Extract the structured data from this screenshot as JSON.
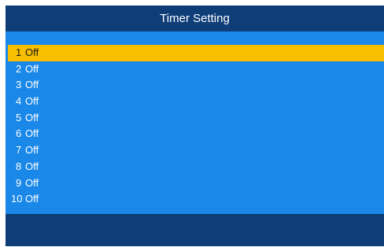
{
  "header": {
    "title": "Timer Setting"
  },
  "colors": {
    "header_bg": "#0e3d78",
    "body_bg": "#1a88e8",
    "selected_bg": "#f7bf00",
    "text": "#ffffff",
    "selected_text": "#1b1b1b"
  },
  "timers": [
    {
      "num": "1",
      "value": "Off"
    },
    {
      "num": "2",
      "value": "Off"
    },
    {
      "num": "3",
      "value": "Off"
    },
    {
      "num": "4",
      "value": "Off"
    },
    {
      "num": "5",
      "value": "Off"
    },
    {
      "num": "6",
      "value": "Off"
    },
    {
      "num": "7",
      "value": "Off"
    },
    {
      "num": "8",
      "value": "Off"
    },
    {
      "num": "9",
      "value": "Off"
    },
    {
      "num": "10",
      "value": "Off"
    }
  ],
  "selected_index": 0
}
